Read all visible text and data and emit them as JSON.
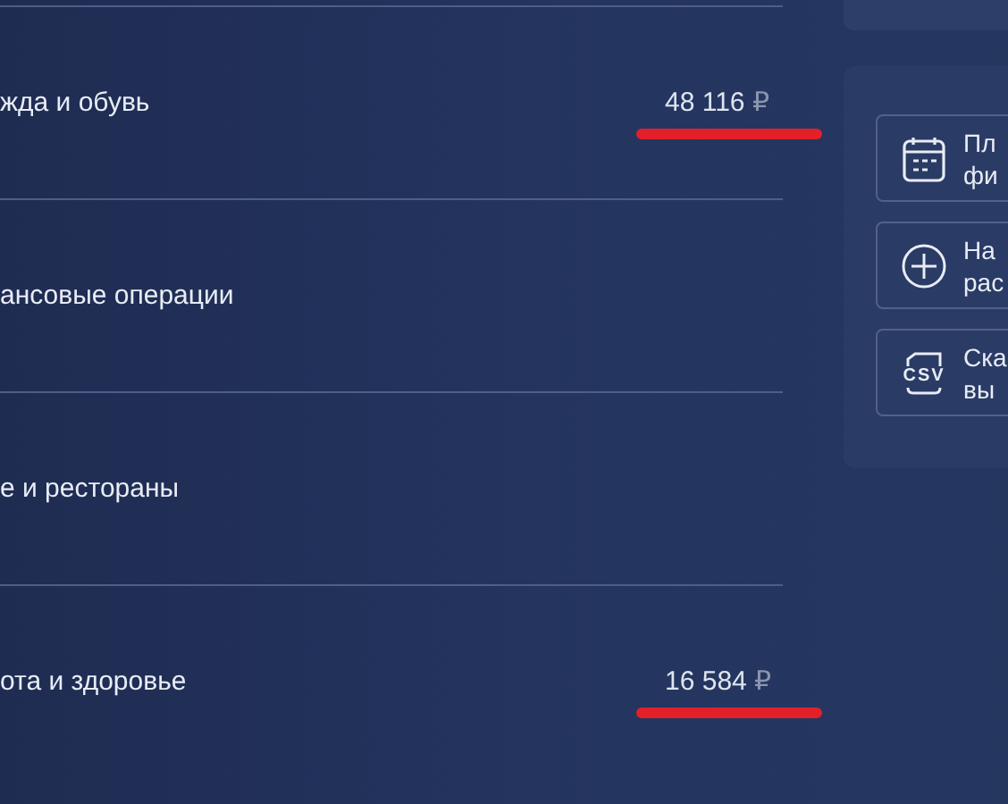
{
  "categories": [
    {
      "name": "жда и обувь",
      "amount": "48 116",
      "currency": "₽",
      "underlined": true
    },
    {
      "name": "ансовые операции",
      "underlined": false
    },
    {
      "name": "е и рестораны",
      "underlined": false
    },
    {
      "name": "ота и здоровье",
      "amount": "16 584",
      "currency": "₽",
      "underlined": true
    }
  ],
  "actions": [
    {
      "kind": "calendar",
      "lines": [
        "Пл",
        "фи"
      ]
    },
    {
      "kind": "plus",
      "lines": [
        "На",
        "рас"
      ]
    },
    {
      "kind": "csv",
      "icon_text": "CSV",
      "lines": [
        "Ска",
        "вы"
      ]
    }
  ]
}
